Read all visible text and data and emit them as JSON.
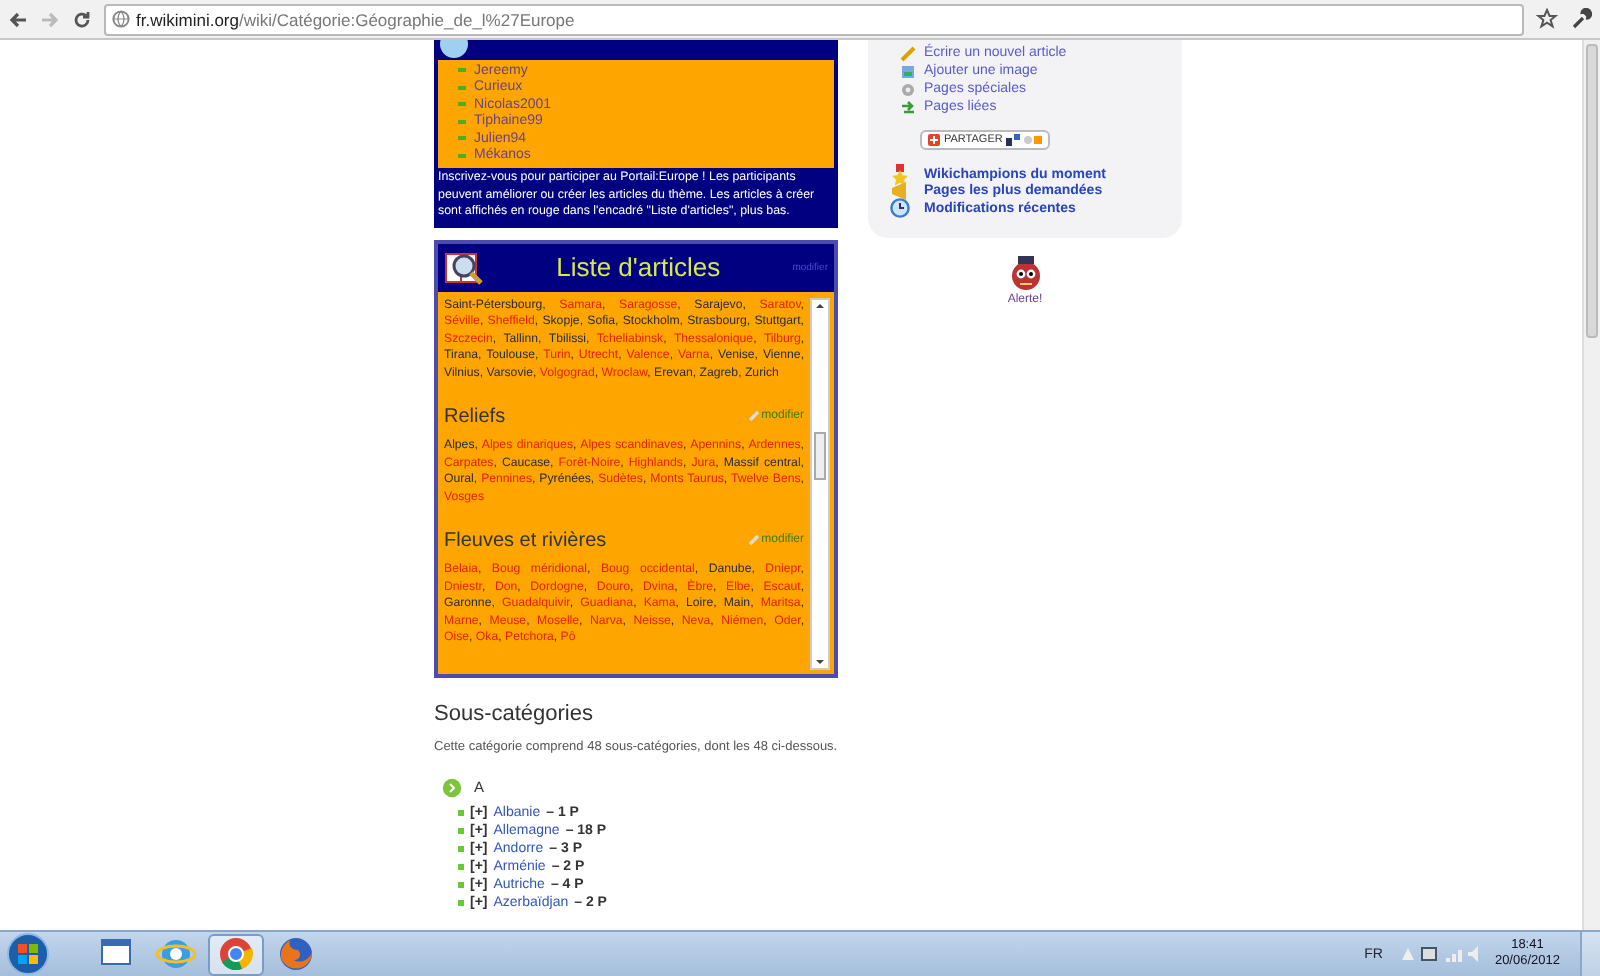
{
  "browser": {
    "url_host": "fr.wikimini.org",
    "url_path": "/wiki/Catégorie:Géographie_de_l%27Europe"
  },
  "portal": {
    "participants": [
      "Jereemy",
      "Curieux",
      "Nicolas2001",
      "Tiphaine99",
      "Julien94",
      "Mékanos"
    ],
    "intro": "Inscrivez-vous pour participer au Portail:Europe ! Les participants peuvent améliorer ou créer les articles du thème. Les articles à créer sont affichés en rouge dans l'encadré \"Liste d'articles\", plus bas."
  },
  "articles_box": {
    "title": "Liste d'articles",
    "edit_link": "modifier",
    "sections": [
      {
        "separator": ",",
        "links": [
          {
            "text": "Saint-Pétersbourg",
            "missing": false
          },
          {
            "text": "Samara",
            "missing": true
          },
          {
            "text": "Saragosse",
            "missing": true
          },
          {
            "text": "Sarajevo",
            "missing": false
          },
          {
            "text": "Saratov",
            "missing": true
          },
          {
            "text": "Séville",
            "missing": true
          },
          {
            "text": "Sheffield",
            "missing": true
          },
          {
            "text": "Skopje",
            "missing": false
          },
          {
            "text": "Sofia",
            "missing": false
          },
          {
            "text": "Stockholm",
            "missing": false
          },
          {
            "text": "Strasbourg",
            "missing": false
          },
          {
            "text": "Stuttgart",
            "missing": false
          },
          {
            "text": "Szczecin",
            "missing": true
          },
          {
            "text": "Tallinn",
            "missing": false
          },
          {
            "text": "Tbilissi",
            "missing": false
          },
          {
            "text": "Tcheliabinsk",
            "missing": true
          },
          {
            "text": "Thessalonique",
            "missing": true
          },
          {
            "text": "Tilburg",
            "missing": true
          },
          {
            "text": "Tirana",
            "missing": false
          },
          {
            "text": "Toulouse",
            "missing": false
          },
          {
            "text": "Turin",
            "missing": true
          },
          {
            "text": "Utrecht",
            "missing": true
          },
          {
            "text": "Valence",
            "missing": true
          },
          {
            "text": "Varna",
            "missing": true
          },
          {
            "text": "Venise",
            "missing": false
          },
          {
            "text": "Vienne",
            "missing": false
          },
          {
            "text": "Vilnius",
            "missing": false
          },
          {
            "text": "Varsovie",
            "missing": false
          },
          {
            "text": "Volgograd",
            "missing": true
          },
          {
            "text": "Wroclaw",
            "missing": true
          },
          {
            "text": "Erevan",
            "missing": false
          },
          {
            "text": "Zagreb",
            "missing": false
          },
          {
            "text": "Zurich",
            "missing": false
          }
        ]
      },
      {
        "heading": "Reliefs",
        "edit_link": "modifier",
        "separator": ",",
        "links": [
          {
            "text": "Alpes",
            "missing": false
          },
          {
            "text": "Alpes dinariques",
            "missing": true
          },
          {
            "text": "Alpes scandinaves",
            "missing": true
          },
          {
            "text": "Apennins",
            "missing": true
          },
          {
            "text": "Ardennes",
            "missing": true
          },
          {
            "text": "Carpates",
            "missing": true
          },
          {
            "text": "Caucase",
            "missing": false
          },
          {
            "text": "Forêt-Noire",
            "missing": true
          },
          {
            "text": "Highlands",
            "missing": true
          },
          {
            "text": "Jura",
            "missing": true
          },
          {
            "text": "Massif central",
            "missing": false
          },
          {
            "text": "Oural",
            "missing": false
          },
          {
            "text": "Pennines",
            "missing": true
          },
          {
            "text": "Pyrénées",
            "missing": false
          },
          {
            "text": "Sudètes",
            "missing": true
          },
          {
            "text": "Monts Taurus",
            "missing": true
          },
          {
            "text": "Twelve Bens",
            "missing": true
          },
          {
            "text": "Vosges",
            "missing": true
          }
        ]
      },
      {
        "heading": "Fleuves et rivières",
        "edit_link": "modifier",
        "separator": ",",
        "links": [
          {
            "text": "Belaia",
            "missing": true
          },
          {
            "text": "Boug méridional",
            "missing": true
          },
          {
            "text": "Boug occidental",
            "missing": true
          },
          {
            "text": "Danube",
            "missing": false
          },
          {
            "text": "Dniepr",
            "missing": true
          },
          {
            "text": "Dniestr",
            "missing": true
          },
          {
            "text": "Don",
            "missing": true
          },
          {
            "text": "Dordogne",
            "missing": true
          },
          {
            "text": "Douro",
            "missing": true
          },
          {
            "text": "Dvina",
            "missing": true
          },
          {
            "text": "Èbre",
            "missing": true
          },
          {
            "text": "Elbe",
            "missing": true
          },
          {
            "text": "Escaut",
            "missing": true
          },
          {
            "text": "Garonne",
            "missing": false
          },
          {
            "text": "Guadalquivir",
            "missing": true
          },
          {
            "text": "Guadiana",
            "missing": true
          },
          {
            "text": "Kama",
            "missing": true
          },
          {
            "text": "Loire",
            "missing": false
          },
          {
            "text": "Main",
            "missing": false
          },
          {
            "text": "Maritsa",
            "missing": true
          },
          {
            "text": "Marne",
            "missing": true
          },
          {
            "text": "Meuse",
            "missing": true
          },
          {
            "text": "Moselle",
            "missing": true
          },
          {
            "text": "Narva",
            "missing": true
          },
          {
            "text": "Neisse",
            "missing": true
          },
          {
            "text": "Neva",
            "missing": true
          },
          {
            "text": "Niémen",
            "missing": true
          },
          {
            "text": "Oder",
            "missing": true
          },
          {
            "text": "Oise",
            "missing": true
          },
          {
            "text": "Oka",
            "missing": true
          },
          {
            "text": "Petchora",
            "missing": true
          },
          {
            "text": "Pô",
            "missing": true
          }
        ]
      }
    ]
  },
  "subcategories": {
    "heading": "Sous-catégories",
    "description": "Cette catégorie comprend 48 sous-catégories, dont les 48 ci-dessous.",
    "groups": [
      {
        "letter": "A",
        "items": [
          {
            "prefix": "[+]",
            "name": "Albanie",
            "count": "– 1 P"
          },
          {
            "prefix": "[+]",
            "name": "Allemagne",
            "count": "– 18 P"
          },
          {
            "prefix": "[+]",
            "name": "Andorre",
            "count": "– 3 P"
          },
          {
            "prefix": "[+]",
            "name": "Arménie",
            "count": "– 2 P"
          },
          {
            "prefix": "[+]",
            "name": "Autriche",
            "count": "– 4 P"
          },
          {
            "prefix": "[+]",
            "name": "Azerbaïdjan",
            "count": "– 2 P"
          }
        ]
      }
    ]
  },
  "sidebar": {
    "tools": [
      {
        "label": "Écrire un nouvel article",
        "kind": "pencil"
      },
      {
        "label": "Ajouter une image",
        "kind": "image"
      },
      {
        "label": "Pages spéciales",
        "kind": "gear"
      },
      {
        "label": "Pages liées",
        "kind": "arrows"
      }
    ],
    "share_button": "PARTAGER",
    "highlights": [
      {
        "label": "Wikichampions du moment",
        "kind": "star"
      },
      {
        "label": "Pages les plus demandées",
        "kind": "horn"
      },
      {
        "label": "Modifications récentes",
        "kind": "clock"
      }
    ],
    "mascot_caption": "Alerte!"
  },
  "taskbar": {
    "apps": [
      {
        "kind": "explorer",
        "selected": false
      },
      {
        "kind": "ie",
        "selected": false
      },
      {
        "kind": "chrome",
        "selected": true
      },
      {
        "kind": "firefox",
        "selected": false
      }
    ],
    "language": "FR",
    "time": "18:41",
    "date": "20/06/2012"
  }
}
